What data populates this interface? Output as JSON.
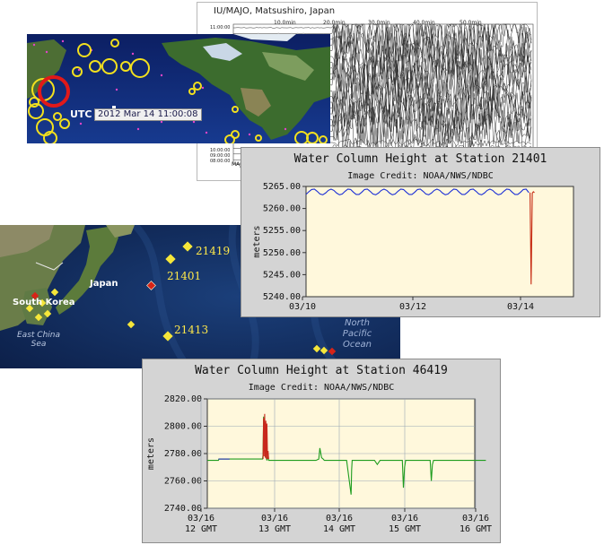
{
  "seismogram": {
    "title": "IU/MAJO, Matsushiro, Japan",
    "minute_ticks": [
      "10.0min",
      "20.0min",
      "30.0min",
      "40.0min",
      "50.0min"
    ],
    "left_times": [
      "11:00:00",
      "10:00:00",
      "09:00:00",
      "08:00:00"
    ],
    "bottom_label": "MAJ"
  },
  "quake_map": {
    "utc_label": "UTC",
    "timestamp": "2012 Mar 14 11:00:08"
  },
  "ocean_map": {
    "labels": {
      "japan": "Japan",
      "south_korea": "South Korea",
      "east_china_sea": "East China Sea",
      "north_pacific": "North Pacific Ocean"
    },
    "buoys": [
      "21419",
      "21401",
      "21413"
    ]
  },
  "charts": [
    {
      "title": "Water Column Height at Station 21401",
      "credit": "Image Credit: NOAA/NWS/NDBC"
    },
    {
      "title": "Water Column Height at Station 46419",
      "credit": "Image Credit: NOAA/NWS/NDBC"
    }
  ],
  "chart_data": [
    {
      "type": "line",
      "title": "Water Column Height at Station 21401",
      "ylabel": "meters",
      "xlabel": "",
      "ylim": [
        5240,
        5265
      ],
      "yticks": [
        "5265.00",
        "5260.00",
        "5255.00",
        "5250.00",
        "5245.00",
        "5240.00"
      ],
      "xticks": [
        "03/10",
        "03/12",
        "03/14"
      ],
      "grid": false,
      "series": [
        {
          "color": "#1c2fd6",
          "x": [
            0,
            0.25,
            0.5,
            0.75,
            1,
            1.25,
            1.5,
            1.75,
            2,
            2.25,
            2.5,
            2.75,
            3,
            3.25,
            3.5,
            3.75,
            4,
            4.25,
            4.5,
            4.75,
            5,
            5.25,
            5.5,
            5.75,
            6,
            6.25,
            6.5,
            6.75,
            7,
            7.25,
            7.5,
            7.75,
            8,
            8.25,
            8.5,
            8.75,
            9,
            9.25,
            9.5,
            9.75,
            10,
            10.25,
            10.5,
            10.75,
            11,
            11.25,
            11.5,
            11.75,
            12,
            12.25,
            12.5,
            12.75,
            13,
            13.25,
            13.5,
            13.75,
            14,
            14.25,
            14.5,
            14.75,
            15,
            15.25,
            15.5,
            15.75,
            16,
            16.25,
            16.5,
            16.75,
            17,
            17.25,
            17.5,
            17.75,
            18,
            18.25,
            18.5,
            18.75,
            19,
            19.25,
            19.5,
            19.75,
            20
          ],
          "y": [
            5263.2,
            5263.8,
            5264.3,
            5264.4,
            5263.9,
            5263.3,
            5263.1,
            5263.5,
            5264.1,
            5264.4,
            5264.1,
            5263.5,
            5263.1,
            5263.3,
            5263.9,
            5264.4,
            5264.3,
            5263.7,
            5263.2,
            5263.2,
            5263.7,
            5264.3,
            5264.4,
            5263.9,
            5263.3,
            5263.1,
            5263.5,
            5264.1,
            5264.4,
            5264.1,
            5263.5,
            5263.1,
            5263.3,
            5263.9,
            5264.4,
            5264.3,
            5263.7,
            5263.2,
            5263.2,
            5263.7,
            5264.3,
            5264.4,
            5263.9,
            5263.3,
            5263.1,
            5263.5,
            5264.1,
            5264.4,
            5264.1,
            5263.5,
            5263.1,
            5263.3,
            5263.9,
            5264.4,
            5264.3,
            5263.7,
            5263.2,
            5263.2,
            5263.7,
            5264.3,
            5264.4,
            5263.9,
            5263.3,
            5263.1,
            5263.5,
            5264.1,
            5264.4,
            5264.1,
            5263.5,
            5263.1,
            5263.3,
            5263.9,
            5264.4,
            5264.3,
            5263.7,
            5263.2,
            5263.2,
            5263.7,
            5264.3,
            5264.4,
            5263.6
          ]
        },
        {
          "color": "#c62a12",
          "x": [
            20.1,
            20.2,
            20.3,
            20.4,
            20.5
          ],
          "y": [
            5263.6,
            5242.8,
            5263.5,
            5263.8,
            5263.6
          ]
        }
      ],
      "x_domain": [
        0,
        24
      ]
    },
    {
      "type": "line",
      "title": "Water Column Height at Station 46419",
      "ylabel": "meters",
      "xlabel": "",
      "ylim": [
        2740,
        2820
      ],
      "yticks": [
        "2820.00",
        "2800.00",
        "2780.00",
        "2760.00",
        "2740.00"
      ],
      "xticks": [
        "03/16\n12 GMT",
        "03/16\n13 GMT",
        "03/16\n14 GMT",
        "03/16\n15 GMT",
        "03/16\n16 GMT"
      ],
      "grid": true,
      "series": [
        {
          "color": "#1f9d1f",
          "x": [
            0,
            0.2,
            0.21,
            0.5,
            0.99,
            1.0,
            1.01,
            1.05,
            1.07,
            1.09,
            1.1,
            1.2,
            1.4,
            1.6,
            1.8,
            1.95,
            2.0,
            2.02,
            2.05,
            2.08,
            2.1,
            2.3,
            2.5,
            2.58,
            2.59,
            2.6,
            2.61,
            2.7,
            2.9,
            3.0,
            3.05,
            3.1,
            3.15,
            3.4,
            3.5,
            3.52,
            3.54,
            3.56,
            3.6,
            3.8,
            4.0,
            4.02,
            4.04,
            4.06,
            4.1,
            4.3,
            4.6,
            4.63,
            4.66,
            4.7,
            4.75,
            5.0
          ],
          "y": [
            2775,
            2775,
            2776,
            2776,
            2776,
            2779,
            2807,
            2779,
            2775,
            2780,
            2775,
            2775,
            2775,
            2775,
            2775,
            2775,
            2776,
            2784,
            2777,
            2776,
            2775,
            2775,
            2775,
            2750,
            2768,
            2775,
            2775,
            2775,
            2775,
            2775,
            2772,
            2775,
            2775,
            2775,
            2775,
            2755,
            2770,
            2775,
            2775,
            2775,
            2775,
            2760,
            2772,
            2775,
            2775,
            2775,
            2775,
            2775,
            2775,
            2775,
            2775,
            2775
          ]
        },
        {
          "color": "#2030b0",
          "x": [
            0.2,
            0.4
          ],
          "y": [
            2776,
            2776
          ]
        },
        {
          "color": "#c8281c",
          "x": [
            1.0,
            1.01,
            1.02,
            1.03,
            1.04,
            1.05,
            1.06,
            1.07,
            1.08,
            1.09,
            1.1
          ],
          "y": [
            2776,
            2806,
            2778,
            2809,
            2777,
            2804,
            2776,
            2802,
            2776,
            2782,
            2776
          ]
        }
      ],
      "x_domain": [
        0,
        4.8
      ]
    }
  ]
}
